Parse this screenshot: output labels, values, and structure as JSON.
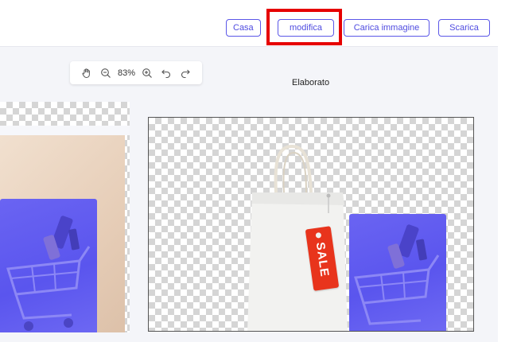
{
  "header": {
    "buttons": [
      {
        "label": "Casa"
      },
      {
        "label": "modifica"
      },
      {
        "label": "Carica immagine"
      },
      {
        "label": "Scarica"
      }
    ],
    "highlighted": "modifica"
  },
  "toolbar": {
    "zoom": "83%",
    "tools": [
      "hand-icon",
      "zoom-out-icon",
      "zoom-in-icon",
      "undo-icon",
      "redo-icon"
    ]
  },
  "panels": {
    "processed_label": "Elaborato"
  },
  "product": {
    "tag_text": "SALE"
  },
  "colors": {
    "accent": "#5b57e8",
    "highlight": "#e60000",
    "tag": "#e8341c",
    "card": "#5f5af0"
  }
}
